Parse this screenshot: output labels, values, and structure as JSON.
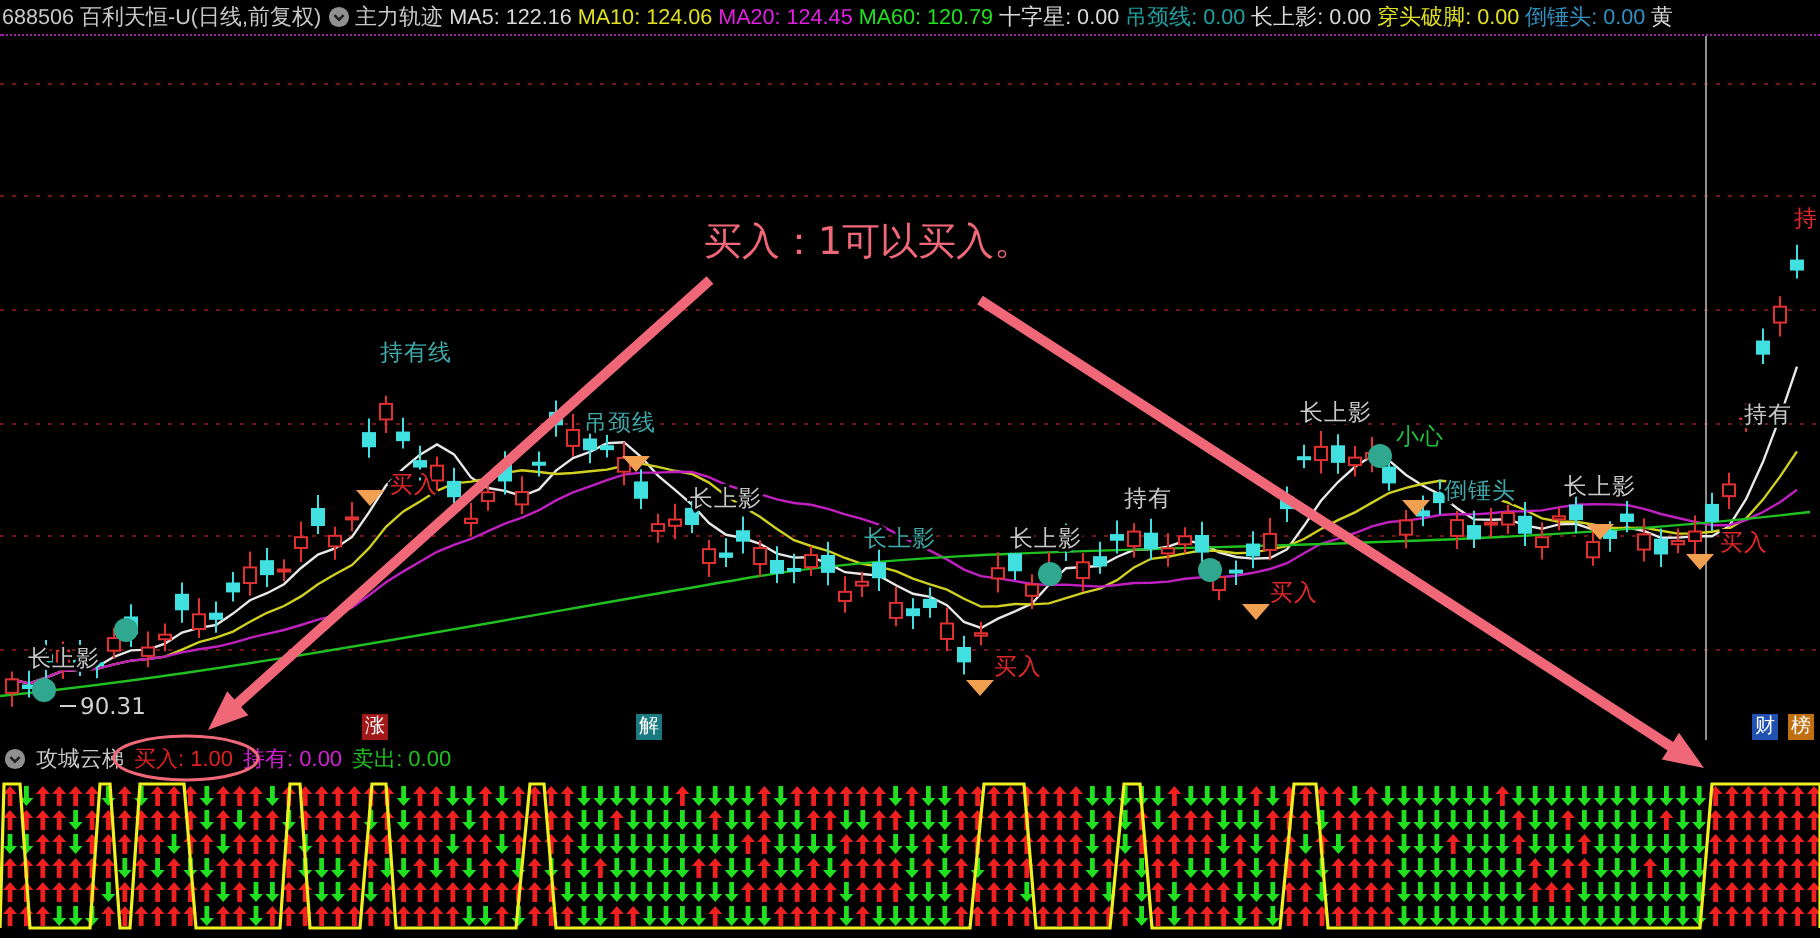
{
  "header": {
    "title": "688506 百利天恒-U(日线,前复权)",
    "indicator_name": "主力轨迹",
    "values": [
      {
        "text": "MA5: 122.16",
        "color": "#d8d8d8"
      },
      {
        "text": "MA10: 124.06",
        "color": "#e0e020"
      },
      {
        "text": "MA20: 124.45",
        "color": "#e020e0"
      },
      {
        "text": "MA60: 120.79",
        "color": "#20e020"
      },
      {
        "text": "十字星: 0.00",
        "color": "#d8d8d8"
      },
      {
        "text": "吊颈线: 0.00",
        "color": "#20a0a0"
      },
      {
        "text": "长上影: 0.00",
        "color": "#d8d8d8"
      },
      {
        "text": "穿头破脚: 0.00",
        "color": "#e0e020"
      },
      {
        "text": "倒锤头: 0.00",
        "color": "#3090c0"
      },
      {
        "text": "黄",
        "color": "#d8d8d8"
      }
    ]
  },
  "main_chart": {
    "price_label": "90.31",
    "markers": [
      {
        "text": "长上影",
        "kind": "pattern"
      },
      {
        "text": "持有线",
        "kind": "signal"
      },
      {
        "text": "买入",
        "kind": "buy"
      },
      {
        "text": "吊颈线",
        "kind": "signal"
      },
      {
        "text": "长上影",
        "kind": "pattern"
      },
      {
        "text": "长上影",
        "kind": "signal"
      },
      {
        "text": "长上影",
        "kind": "pattern"
      },
      {
        "text": "买入",
        "kind": "buy"
      },
      {
        "text": "持有",
        "kind": "pattern"
      },
      {
        "text": "买入",
        "kind": "buy"
      },
      {
        "text": "长上影",
        "kind": "pattern"
      },
      {
        "text": "小心",
        "kind": "caution"
      },
      {
        "text": "倒锤头",
        "kind": "signal"
      },
      {
        "text": "长上影",
        "kind": "pattern"
      },
      {
        "text": "买入",
        "kind": "buy"
      },
      {
        "text": "持有",
        "kind": "pattern"
      },
      {
        "text": "持",
        "kind": "buy"
      }
    ],
    "badges": [
      {
        "text": "涨",
        "color": "#a01818"
      },
      {
        "text": "解",
        "color": "#1a7a80"
      },
      {
        "text": "财",
        "color": "#2050b0"
      },
      {
        "text": "榜",
        "color": "#c07010"
      }
    ]
  },
  "callout": {
    "text": "买入：1可以买入。"
  },
  "lower_panel": {
    "indicator_name": "攻城云梯",
    "values": [
      {
        "text": "买入: 1.00",
        "color": "#e02020"
      },
      {
        "text": "持有: 0.00",
        "color": "#d020d0"
      },
      {
        "text": "卖出: 0.00",
        "color": "#20c020"
      }
    ]
  }
}
